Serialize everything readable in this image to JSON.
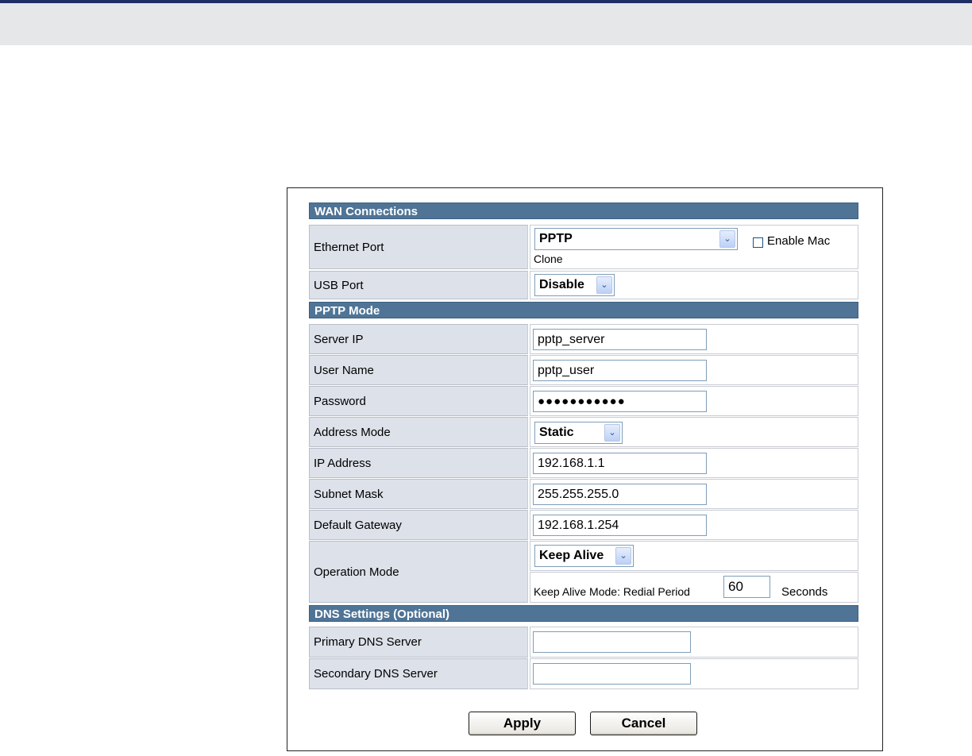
{
  "sections": {
    "wan": "WAN Connections",
    "pptp": "PPTP Mode",
    "dns": "DNS Settings (Optional)"
  },
  "wan": {
    "ethernet_port": {
      "label": "Ethernet Port",
      "selected": "PPTP",
      "mac_clone_label_1": "Enable Mac",
      "mac_clone_label_2": "Clone",
      "mac_clone_checked": false
    },
    "usb_port": {
      "label": "USB Port",
      "selected": "Disable"
    }
  },
  "pptp": {
    "server_ip": {
      "label": "Server IP",
      "value": "pptp_server"
    },
    "user_name": {
      "label": "User Name",
      "value": "pptp_user"
    },
    "password": {
      "label": "Password",
      "value": "●●●●●●●●●●●"
    },
    "address_mode": {
      "label": "Address Mode",
      "selected": "Static"
    },
    "ip_address": {
      "label": "IP Address",
      "value": "192.168.1.1"
    },
    "subnet_mask": {
      "label": "Subnet Mask",
      "value": "255.255.255.0"
    },
    "default_gateway": {
      "label": "Default Gateway",
      "value": "192.168.1.254"
    },
    "operation_mode": {
      "label": "Operation Mode",
      "selected": "Keep Alive",
      "redial_text": "Keep Alive Mode: Redial Period",
      "redial_value": "60",
      "redial_unit": "Seconds"
    }
  },
  "dns": {
    "primary": {
      "label": "Primary DNS Server",
      "value": ""
    },
    "secondary": {
      "label": "Secondary DNS Server",
      "value": ""
    }
  },
  "buttons": {
    "apply": "Apply",
    "cancel": "Cancel"
  },
  "icons": {
    "dropdown": "chevron-down-icon"
  },
  "colors": {
    "section_header": "#4f7496",
    "label_cell": "#dde1e9",
    "top_rule": "#1f2f63",
    "top_band": "#e6e7e9"
  }
}
